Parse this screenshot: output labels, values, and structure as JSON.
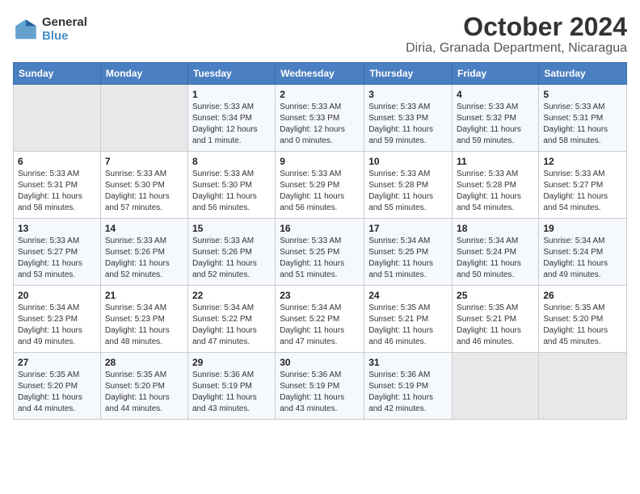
{
  "header": {
    "logo_general": "General",
    "logo_blue": "Blue",
    "title": "October 2024",
    "subtitle": "Diria, Granada Department, Nicaragua"
  },
  "weekdays": [
    "Sunday",
    "Monday",
    "Tuesday",
    "Wednesday",
    "Thursday",
    "Friday",
    "Saturday"
  ],
  "weeks": [
    [
      {
        "day": "",
        "info": ""
      },
      {
        "day": "",
        "info": ""
      },
      {
        "day": "1",
        "info": "Sunrise: 5:33 AM\nSunset: 5:34 PM\nDaylight: 12 hours and 1 minute."
      },
      {
        "day": "2",
        "info": "Sunrise: 5:33 AM\nSunset: 5:33 PM\nDaylight: 12 hours and 0 minutes."
      },
      {
        "day": "3",
        "info": "Sunrise: 5:33 AM\nSunset: 5:33 PM\nDaylight: 11 hours and 59 minutes."
      },
      {
        "day": "4",
        "info": "Sunrise: 5:33 AM\nSunset: 5:32 PM\nDaylight: 11 hours and 59 minutes."
      },
      {
        "day": "5",
        "info": "Sunrise: 5:33 AM\nSunset: 5:31 PM\nDaylight: 11 hours and 58 minutes."
      }
    ],
    [
      {
        "day": "6",
        "info": "Sunrise: 5:33 AM\nSunset: 5:31 PM\nDaylight: 11 hours and 58 minutes."
      },
      {
        "day": "7",
        "info": "Sunrise: 5:33 AM\nSunset: 5:30 PM\nDaylight: 11 hours and 57 minutes."
      },
      {
        "day": "8",
        "info": "Sunrise: 5:33 AM\nSunset: 5:30 PM\nDaylight: 11 hours and 56 minutes."
      },
      {
        "day": "9",
        "info": "Sunrise: 5:33 AM\nSunset: 5:29 PM\nDaylight: 11 hours and 56 minutes."
      },
      {
        "day": "10",
        "info": "Sunrise: 5:33 AM\nSunset: 5:28 PM\nDaylight: 11 hours and 55 minutes."
      },
      {
        "day": "11",
        "info": "Sunrise: 5:33 AM\nSunset: 5:28 PM\nDaylight: 11 hours and 54 minutes."
      },
      {
        "day": "12",
        "info": "Sunrise: 5:33 AM\nSunset: 5:27 PM\nDaylight: 11 hours and 54 minutes."
      }
    ],
    [
      {
        "day": "13",
        "info": "Sunrise: 5:33 AM\nSunset: 5:27 PM\nDaylight: 11 hours and 53 minutes."
      },
      {
        "day": "14",
        "info": "Sunrise: 5:33 AM\nSunset: 5:26 PM\nDaylight: 11 hours and 52 minutes."
      },
      {
        "day": "15",
        "info": "Sunrise: 5:33 AM\nSunset: 5:26 PM\nDaylight: 11 hours and 52 minutes."
      },
      {
        "day": "16",
        "info": "Sunrise: 5:33 AM\nSunset: 5:25 PM\nDaylight: 11 hours and 51 minutes."
      },
      {
        "day": "17",
        "info": "Sunrise: 5:34 AM\nSunset: 5:25 PM\nDaylight: 11 hours and 51 minutes."
      },
      {
        "day": "18",
        "info": "Sunrise: 5:34 AM\nSunset: 5:24 PM\nDaylight: 11 hours and 50 minutes."
      },
      {
        "day": "19",
        "info": "Sunrise: 5:34 AM\nSunset: 5:24 PM\nDaylight: 11 hours and 49 minutes."
      }
    ],
    [
      {
        "day": "20",
        "info": "Sunrise: 5:34 AM\nSunset: 5:23 PM\nDaylight: 11 hours and 49 minutes."
      },
      {
        "day": "21",
        "info": "Sunrise: 5:34 AM\nSunset: 5:23 PM\nDaylight: 11 hours and 48 minutes."
      },
      {
        "day": "22",
        "info": "Sunrise: 5:34 AM\nSunset: 5:22 PM\nDaylight: 11 hours and 47 minutes."
      },
      {
        "day": "23",
        "info": "Sunrise: 5:34 AM\nSunset: 5:22 PM\nDaylight: 11 hours and 47 minutes."
      },
      {
        "day": "24",
        "info": "Sunrise: 5:35 AM\nSunset: 5:21 PM\nDaylight: 11 hours and 46 minutes."
      },
      {
        "day": "25",
        "info": "Sunrise: 5:35 AM\nSunset: 5:21 PM\nDaylight: 11 hours and 46 minutes."
      },
      {
        "day": "26",
        "info": "Sunrise: 5:35 AM\nSunset: 5:20 PM\nDaylight: 11 hours and 45 minutes."
      }
    ],
    [
      {
        "day": "27",
        "info": "Sunrise: 5:35 AM\nSunset: 5:20 PM\nDaylight: 11 hours and 44 minutes."
      },
      {
        "day": "28",
        "info": "Sunrise: 5:35 AM\nSunset: 5:20 PM\nDaylight: 11 hours and 44 minutes."
      },
      {
        "day": "29",
        "info": "Sunrise: 5:36 AM\nSunset: 5:19 PM\nDaylight: 11 hours and 43 minutes."
      },
      {
        "day": "30",
        "info": "Sunrise: 5:36 AM\nSunset: 5:19 PM\nDaylight: 11 hours and 43 minutes."
      },
      {
        "day": "31",
        "info": "Sunrise: 5:36 AM\nSunset: 5:19 PM\nDaylight: 11 hours and 42 minutes."
      },
      {
        "day": "",
        "info": ""
      },
      {
        "day": "",
        "info": ""
      }
    ]
  ]
}
